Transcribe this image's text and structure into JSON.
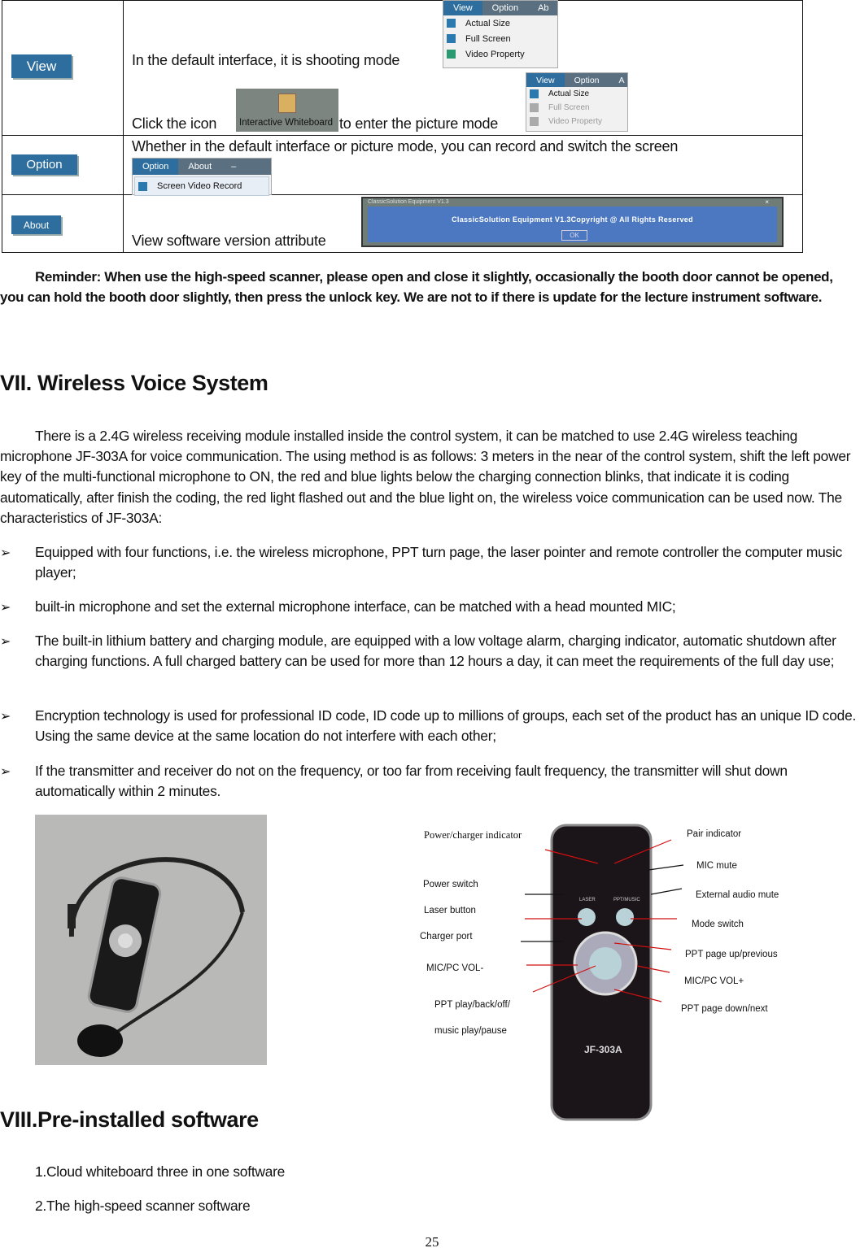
{
  "table": {
    "rows": [
      {
        "button": "View",
        "line1": "In the default interface, it is shooting mode",
        "line2_a": "Click the icon",
        "icon_label": "Interactive Whiteboard",
        "line2_b": "to enter the picture mode",
        "menu_tabs": [
          "View",
          "Option",
          "Ab"
        ],
        "menu_items": [
          "Actual Size",
          "Full Screen",
          "Video Property"
        ],
        "menu2_tabs": [
          "View",
          "Option",
          "A"
        ],
        "menu2_items": [
          "Actual Size",
          "Full Screen",
          "Video Property"
        ]
      },
      {
        "button": "Option",
        "text": "Whether in the default interface or picture mode, you can record and switch the screen",
        "menu_tabs": [
          "Option",
          "About"
        ],
        "menu_item": "Screen Video Record"
      },
      {
        "button": "About",
        "text": "View software version attribute",
        "dialog_title": "ClassicSolution Equipment V1.3",
        "dialog_text": "ClassicSolution Equipment V1.3Copyright @ All Rights Reserved",
        "dialog_ok": "OK"
      }
    ]
  },
  "reminder": "Reminder: When use the high-speed scanner, please open and close it slightly, occasionally the booth door cannot be opened, you can hold the booth door slightly, then press the unlock key. We are not to if there is update for the lecture instrument software.",
  "section7": {
    "title": "VII. Wireless Voice System",
    "intro": "There is a 2.4G wireless receiving module installed inside the control system, it can be matched to use 2.4G wireless teaching microphone JF-303A for voice communication. The using method is as follows: 3 meters in the near of the control system, shift the left power key of the multi-functional microphone to ON, the red and blue lights below the charging connection blinks, that indicate it is coding automatically, after finish the coding, the red light flashed out and the blue light on, the wireless voice communication can be used now. The characteristics of JF-303A:",
    "bullets": [
      "Equipped with four functions, i.e. the wireless microphone, PPT turn page, the laser pointer and remote controller the computer music player;",
      "built-in microphone and set the external microphone interface, can be matched with a head mounted MIC;",
      "The built-in lithium battery and charging module, are equipped with a low voltage alarm, charging indicator, automatic shutdown after charging functions. A full charged battery can be used for more than 12 hours a day, it can meet the requirements of the full day use;",
      "Encryption technology is used for professional ID code, ID code up to millions of groups, each set of the product has an unique ID code. Using the same device at the same location do not interfere with each other;",
      "If the transmitter and receiver do not on the frequency, or too far from receiving fault frequency, the transmitter will shut down automatically within 2 minutes."
    ],
    "bullet_icon": "arrowhead-bullet-icon",
    "diagram": {
      "model": "JF-303A",
      "labels_left": [
        "Power/charger indicator",
        "Power switch",
        "Laser button",
        "Charger port",
        "MIC/PC VOL-",
        "PPT play/back/off/",
        "music play/pause"
      ],
      "labels_right": [
        "Pair indicator",
        "MIC mute",
        "External audio mute",
        "Mode switch",
        "PPT page up/previous",
        "MIC/PC VOL+",
        "PPT page down/next"
      ],
      "device_buttons": [
        "LASER",
        "PPT/MUSIC"
      ],
      "pointer_color": "#d01010"
    }
  },
  "section8": {
    "title": "VIII.Pre-installed software",
    "items": [
      "1.Cloud whiteboard three in one software",
      "2.The high-speed scanner software"
    ]
  },
  "page_number": "25"
}
